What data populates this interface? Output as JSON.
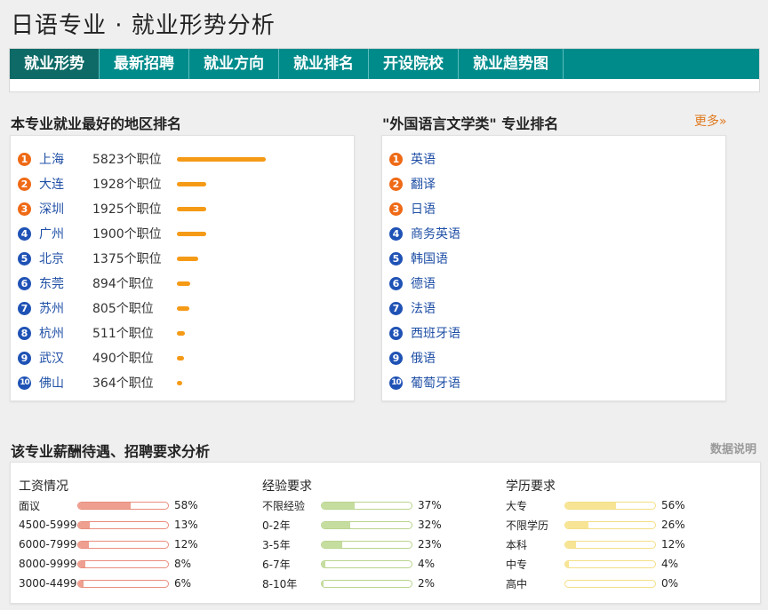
{
  "page": {
    "title": "日语专业 · 就业形势分析"
  },
  "nav": {
    "tabs": [
      {
        "label": "就业形势",
        "active": true
      },
      {
        "label": "最新招聘",
        "active": false
      },
      {
        "label": "就业方向",
        "active": false
      },
      {
        "label": "就业排名",
        "active": false
      },
      {
        "label": "开设院校",
        "active": false
      },
      {
        "label": "就业趋势图",
        "active": false
      }
    ]
  },
  "region_ranking": {
    "title": "本专业就业最好的地区排名",
    "max_count": 5823,
    "items": [
      {
        "rank": "1",
        "name": "上海",
        "count": 5823,
        "count_label": "5823个职位"
      },
      {
        "rank": "2",
        "name": "大连",
        "count": 1928,
        "count_label": "1928个职位"
      },
      {
        "rank": "3",
        "name": "深圳",
        "count": 1925,
        "count_label": "1925个职位"
      },
      {
        "rank": "4",
        "name": "广州",
        "count": 1900,
        "count_label": "1900个职位"
      },
      {
        "rank": "5",
        "name": "北京",
        "count": 1375,
        "count_label": "1375个职位"
      },
      {
        "rank": "6",
        "name": "东莞",
        "count": 894,
        "count_label": "894个职位"
      },
      {
        "rank": "7",
        "name": "苏州",
        "count": 805,
        "count_label": "805个职位"
      },
      {
        "rank": "8",
        "name": "杭州",
        "count": 511,
        "count_label": "511个职位"
      },
      {
        "rank": "9",
        "name": "武汉",
        "count": 490,
        "count_label": "490个职位"
      },
      {
        "rank": "10",
        "name": "佛山",
        "count": 364,
        "count_label": "364个职位"
      }
    ]
  },
  "major_ranking": {
    "title": "\"外国语言文学类\" 专业排名",
    "more_label": "更多»",
    "items": [
      {
        "rank": "1",
        "name": "英语"
      },
      {
        "rank": "2",
        "name": "翻译"
      },
      {
        "rank": "3",
        "name": "日语"
      },
      {
        "rank": "4",
        "name": "商务英语"
      },
      {
        "rank": "5",
        "name": "韩国语"
      },
      {
        "rank": "6",
        "name": "德语"
      },
      {
        "rank": "7",
        "name": "法语"
      },
      {
        "rank": "8",
        "name": "西班牙语"
      },
      {
        "rank": "9",
        "name": "俄语"
      },
      {
        "rank": "10",
        "name": "葡萄牙语"
      }
    ]
  },
  "analysis": {
    "title": "该专业薪酬待遇、招聘要求分析",
    "note_label": "数据说明",
    "salary": {
      "title": "工资情况",
      "items": [
        {
          "label": "面议",
          "pct": 58,
          "pct_label": "58%"
        },
        {
          "label": "4500-5999",
          "pct": 13,
          "pct_label": "13%"
        },
        {
          "label": "6000-7999",
          "pct": 12,
          "pct_label": "12%"
        },
        {
          "label": "8000-9999",
          "pct": 8,
          "pct_label": "8%"
        },
        {
          "label": "3000-4499",
          "pct": 6,
          "pct_label": "6%"
        }
      ]
    },
    "experience": {
      "title": "经验要求",
      "items": [
        {
          "label": "不限经验",
          "pct": 37,
          "pct_label": "37%"
        },
        {
          "label": "0-2年",
          "pct": 32,
          "pct_label": "32%"
        },
        {
          "label": "3-5年",
          "pct": 23,
          "pct_label": "23%"
        },
        {
          "label": "6-7年",
          "pct": 4,
          "pct_label": "4%"
        },
        {
          "label": "8-10年",
          "pct": 2,
          "pct_label": "2%"
        }
      ]
    },
    "education": {
      "title": "学历要求",
      "items": [
        {
          "label": "大专",
          "pct": 56,
          "pct_label": "56%"
        },
        {
          "label": "不限学历",
          "pct": 26,
          "pct_label": "26%"
        },
        {
          "label": "本科",
          "pct": 12,
          "pct_label": "12%"
        },
        {
          "label": "中专",
          "pct": 4,
          "pct_label": "4%"
        },
        {
          "label": "高中",
          "pct": 0,
          "pct_label": "0%"
        }
      ]
    }
  },
  "colors": {
    "nav_bg": "#008b8b",
    "nav_active": "#0e6a66",
    "rank_top": "#ef6a16",
    "rank_rest": "#1f52b5",
    "region_bar": "#f59a16",
    "link": "#1f4fa5",
    "more_link": "#e07a1f"
  }
}
